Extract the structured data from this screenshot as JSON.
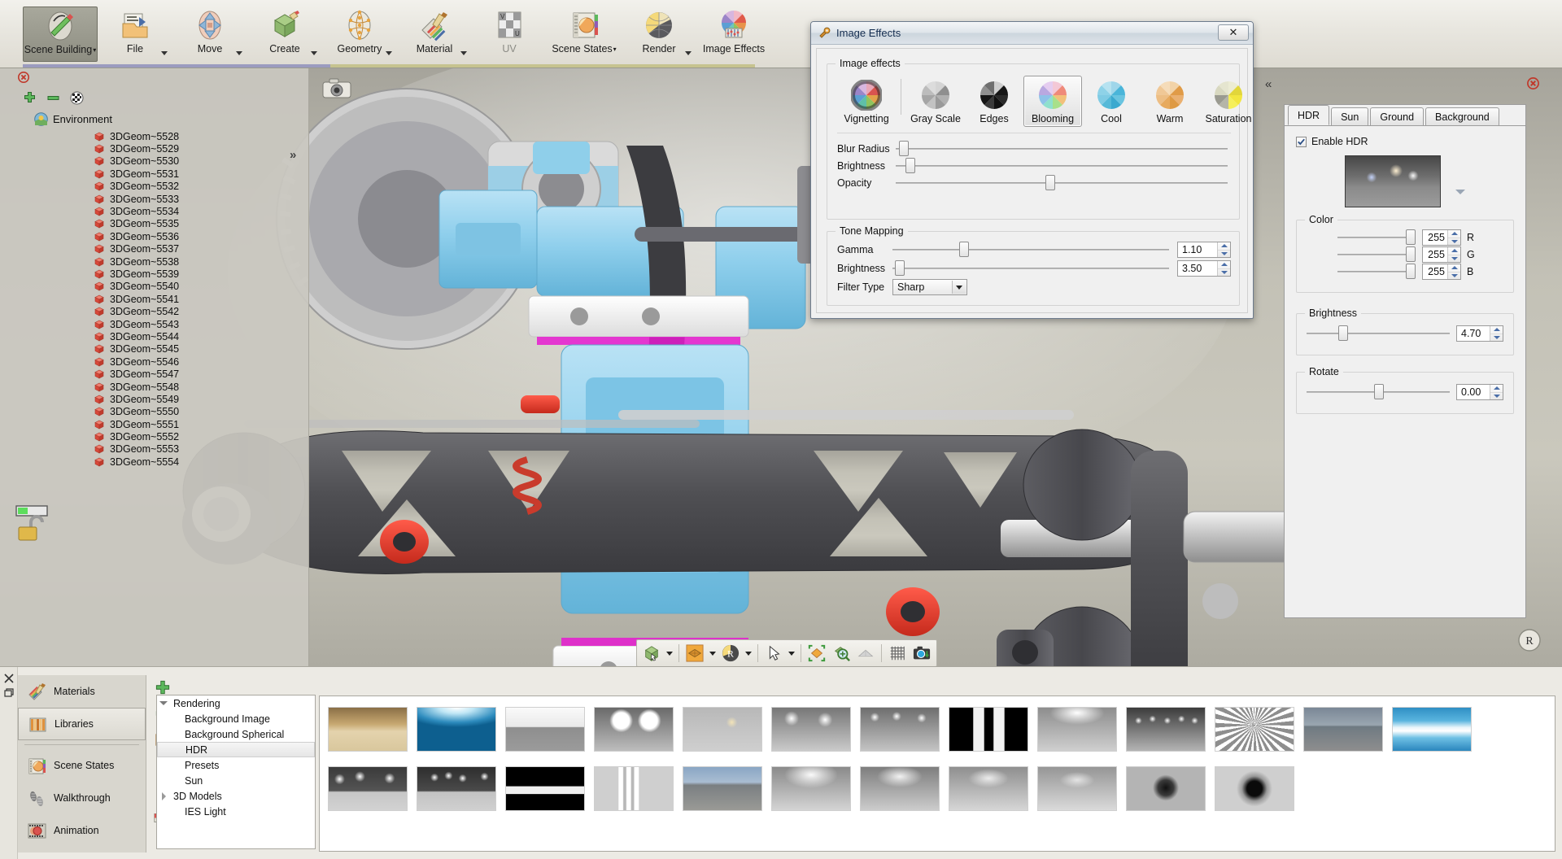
{
  "ribbon": {
    "items": [
      {
        "label": "Scene Building",
        "icon": "scene-building-icon",
        "active": true,
        "split": false,
        "caret": true,
        "dim": false
      },
      {
        "label": "File",
        "icon": "file-folder-icon",
        "active": false,
        "split": true,
        "caret": false,
        "dim": false
      },
      {
        "label": "Move",
        "icon": "move-arrows-icon",
        "active": false,
        "split": true,
        "caret": false,
        "dim": false
      },
      {
        "label": "Create",
        "icon": "create-box-icon",
        "active": false,
        "split": true,
        "caret": false,
        "dim": false
      },
      {
        "label": "Geometry",
        "icon": "geometry-mesh-icon",
        "active": false,
        "split": true,
        "caret": false,
        "dim": false
      },
      {
        "label": "Material",
        "icon": "material-brush-icon",
        "active": false,
        "split": true,
        "caret": false,
        "dim": false
      },
      {
        "label": "UV",
        "icon": "uv-checker-icon",
        "active": false,
        "split": false,
        "caret": false,
        "dim": true
      },
      {
        "label": "Scene States",
        "icon": "scene-states-icon",
        "active": false,
        "split": false,
        "caret": true,
        "dim": false
      },
      {
        "label": "Render",
        "icon": "render-sphere-icon",
        "active": false,
        "split": true,
        "caret": false,
        "dim": false
      },
      {
        "label": "Image Effects",
        "icon": "image-effects-wheel-icon",
        "active": false,
        "split": false,
        "caret": false,
        "dim": false
      }
    ]
  },
  "scene_tree": {
    "root_label": "Environment",
    "items": [
      "3DGeom~5528",
      "3DGeom~5529",
      "3DGeom~5530",
      "3DGeom~5531",
      "3DGeom~5532",
      "3DGeom~5533",
      "3DGeom~5534",
      "3DGeom~5535",
      "3DGeom~5536",
      "3DGeom~5537",
      "3DGeom~5538",
      "3DGeom~5539",
      "3DGeom~5540",
      "3DGeom~5541",
      "3DGeom~5542",
      "3DGeom~5543",
      "3DGeom~5544",
      "3DGeom~5545",
      "3DGeom~5546",
      "3DGeom~5547",
      "3DGeom~5548",
      "3DGeom~5549",
      "3DGeom~5550",
      "3DGeom~5551",
      "3DGeom~5552",
      "3DGeom~5553",
      "3DGeom~5554"
    ]
  },
  "dialog": {
    "title": "Image Effects",
    "close_label": "✕",
    "effects_group_label": "Image effects",
    "effects": [
      {
        "label": "Vignetting",
        "icon": "vignetting-wheel-icon",
        "selected": false
      },
      {
        "label": "Gray Scale",
        "icon": "grayscale-wheel-icon",
        "selected": false
      },
      {
        "label": "Edges",
        "icon": "edges-wheel-icon",
        "selected": false
      },
      {
        "label": "Blooming",
        "icon": "blooming-wheel-icon",
        "selected": true
      },
      {
        "label": "Cool",
        "icon": "cool-wheel-icon",
        "selected": false
      },
      {
        "label": "Warm",
        "icon": "warm-wheel-icon",
        "selected": false
      },
      {
        "label": "Saturation",
        "icon": "saturation-wheel-icon",
        "selected": false
      }
    ],
    "sliders": [
      {
        "label": "Blur Radius",
        "percent": 1
      },
      {
        "label": "Brightness",
        "percent": 3
      },
      {
        "label": "Opacity",
        "percent": 45
      }
    ],
    "tone_mapping": {
      "group_label": "Tone Mapping",
      "gamma": {
        "label": "Gamma",
        "value": "1.10",
        "percent": 24
      },
      "brightness": {
        "label": "Brightness",
        "value": "3.50",
        "percent": 1
      },
      "filter_type": {
        "label": "Filter Type",
        "value": "Sharp"
      }
    }
  },
  "hdr_panel": {
    "tabs": [
      {
        "label": "HDR",
        "active": true
      },
      {
        "label": "Sun",
        "active": false
      },
      {
        "label": "Ground",
        "active": false
      },
      {
        "label": "Background",
        "active": false
      }
    ],
    "enable_label": "Enable HDR",
    "enable_checked": true,
    "color_group_label": "Color",
    "color_channels": [
      {
        "value": "255",
        "channel": "R",
        "percent": 100
      },
      {
        "value": "255",
        "channel": "G",
        "percent": 100
      },
      {
        "value": "255",
        "channel": "B",
        "percent": 100
      }
    ],
    "brightness": {
      "group_label": "Brightness",
      "value": "4.70",
      "percent": 22
    },
    "rotate": {
      "group_label": "Rotate",
      "value": "0.00",
      "percent": 47
    }
  },
  "bottom_panel": {
    "categories": [
      {
        "label": "Materials",
        "icon": "materials-brush-icon",
        "selected": false
      },
      {
        "label": "Libraries",
        "icon": "libraries-books-icon",
        "selected": true
      },
      {
        "label": "Scene States",
        "icon": "scene-states-icon",
        "selected": false
      },
      {
        "label": "Walkthrough",
        "icon": "walkthrough-footsteps-icon",
        "selected": false
      },
      {
        "label": "Animation",
        "icon": "animation-reel-icon",
        "selected": false
      }
    ],
    "side_tools": [
      "add-plus-icon",
      "remove-minus-icon",
      "library-package-icon",
      "download-arrow-icon",
      "import-box-icon",
      "grid-options-icon"
    ],
    "tree": [
      {
        "label": "Rendering",
        "indent": 0,
        "arrow": "open",
        "selected": false
      },
      {
        "label": "Background Image",
        "indent": 1,
        "arrow": "none",
        "selected": false
      },
      {
        "label": "Background Spherical",
        "indent": 1,
        "arrow": "none",
        "selected": false
      },
      {
        "label": "HDR",
        "indent": 1,
        "arrow": "none",
        "selected": true
      },
      {
        "label": "Presets",
        "indent": 1,
        "arrow": "none",
        "selected": false
      },
      {
        "label": "Sun",
        "indent": 1,
        "arrow": "none",
        "selected": false
      },
      {
        "label": "3D Models",
        "indent": 0,
        "arrow": "closed",
        "selected": false
      },
      {
        "label": "IES Light",
        "indent": 1,
        "arrow": "none",
        "selected": false
      }
    ],
    "thumbnails_row1": [
      "hdr-lobby-interior",
      "hdr-blue-sky-gradient",
      "hdr-gray-hills",
      "hdr-two-softboxes",
      "hdr-warm-sun-spot",
      "hdr-studio-overhead-a",
      "hdr-studio-overhead-b",
      "hdr-black-two-panels",
      "hdr-soft-dome",
      "hdr-spotlight-array",
      "hdr-radial-streaks",
      "hdr-outdoor-plaza",
      "hdr-blue-strip-light"
    ],
    "thumbnails_row2": [
      "hdr-dark-room-lights",
      "hdr-dark-room-lights-b",
      "hdr-black-strip-panel",
      "hdr-window-grid",
      "hdr-city-street",
      "hdr-soft-gray-dome",
      "hdr-gray-dome-b",
      "hdr-gray-dome-c",
      "hdr-gray-dome-d",
      "hdr-dark-vignette-dome",
      "hdr-black-square-dome"
    ]
  },
  "viewport_toolbar": {
    "buttons": [
      {
        "icon": "select-object-icon",
        "caret": true
      },
      {
        "icon": "render-mode-icon",
        "caret": true
      },
      {
        "icon": "raytrace-r-icon",
        "caret": true
      },
      {
        "icon": "cursor-arrow-icon",
        "caret": true
      },
      {
        "icon": "fit-selection-icon",
        "caret": false
      },
      {
        "icon": "zoom-magnifier-icon",
        "caret": false
      },
      {
        "icon": "ground-plane-icon",
        "caret": false
      },
      {
        "icon": "grid-toggle-icon",
        "caret": false
      },
      {
        "icon": "snapshot-camera-icon",
        "caret": false
      }
    ]
  },
  "colors": {
    "accent_blue": "#4a6ea8",
    "ribbon_stripe_purple": "#9b9bbf",
    "ribbon_stripe_olive": "#c6c38f",
    "highlight_red": "#c0392b",
    "geom_icon_red": "#e0584a"
  }
}
